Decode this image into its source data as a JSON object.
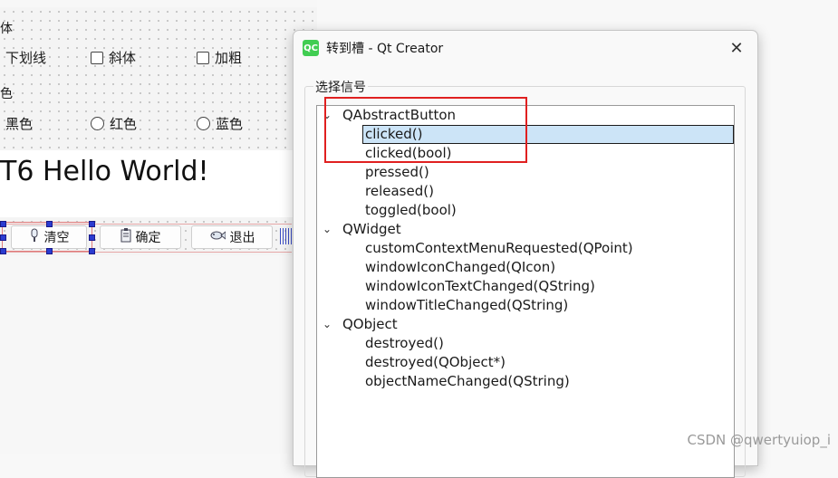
{
  "designer": {
    "font_group_label": "体",
    "font_options": [
      "下划线",
      "斜体",
      "加粗"
    ],
    "color_group_label": "色",
    "color_options": [
      "黑色",
      "红色",
      "蓝色"
    ],
    "hello_text": "T6 Hello World!",
    "buttons": [
      {
        "label": "清空",
        "icon": "broom-icon"
      },
      {
        "label": "确定",
        "icon": "ok-doc-icon"
      },
      {
        "label": "退出",
        "icon": "fish-icon"
      }
    ]
  },
  "dialog": {
    "logo_text": "QC",
    "title": "转到槽 - Qt Creator",
    "group_title": "选择信号",
    "tree": [
      {
        "label": "QAbstractButton",
        "level": 0,
        "expanded": true
      },
      {
        "label": "clicked()",
        "level": 1,
        "selected": true
      },
      {
        "label": "clicked(bool)",
        "level": 1
      },
      {
        "label": "pressed()",
        "level": 1
      },
      {
        "label": "released()",
        "level": 1
      },
      {
        "label": "toggled(bool)",
        "level": 1
      },
      {
        "label": "QWidget",
        "level": 0,
        "expanded": true
      },
      {
        "label": "customContextMenuRequested(QPoint)",
        "level": 1
      },
      {
        "label": "windowIconChanged(QIcon)",
        "level": 1
      },
      {
        "label": "windowIconTextChanged(QString)",
        "level": 1
      },
      {
        "label": "windowTitleChanged(QString)",
        "level": 1
      },
      {
        "label": "QObject",
        "level": 0,
        "expanded": true
      },
      {
        "label": "destroyed()",
        "level": 1
      },
      {
        "label": "destroyed(QObject*)",
        "level": 1
      },
      {
        "label": "objectNameChanged(QString)",
        "level": 1
      }
    ]
  },
  "watermark": "CSDN @qwertyuiop_i",
  "colors": {
    "selection": "#cce4f7",
    "annotation": "#e02020",
    "qt_green": "#41cd52"
  }
}
